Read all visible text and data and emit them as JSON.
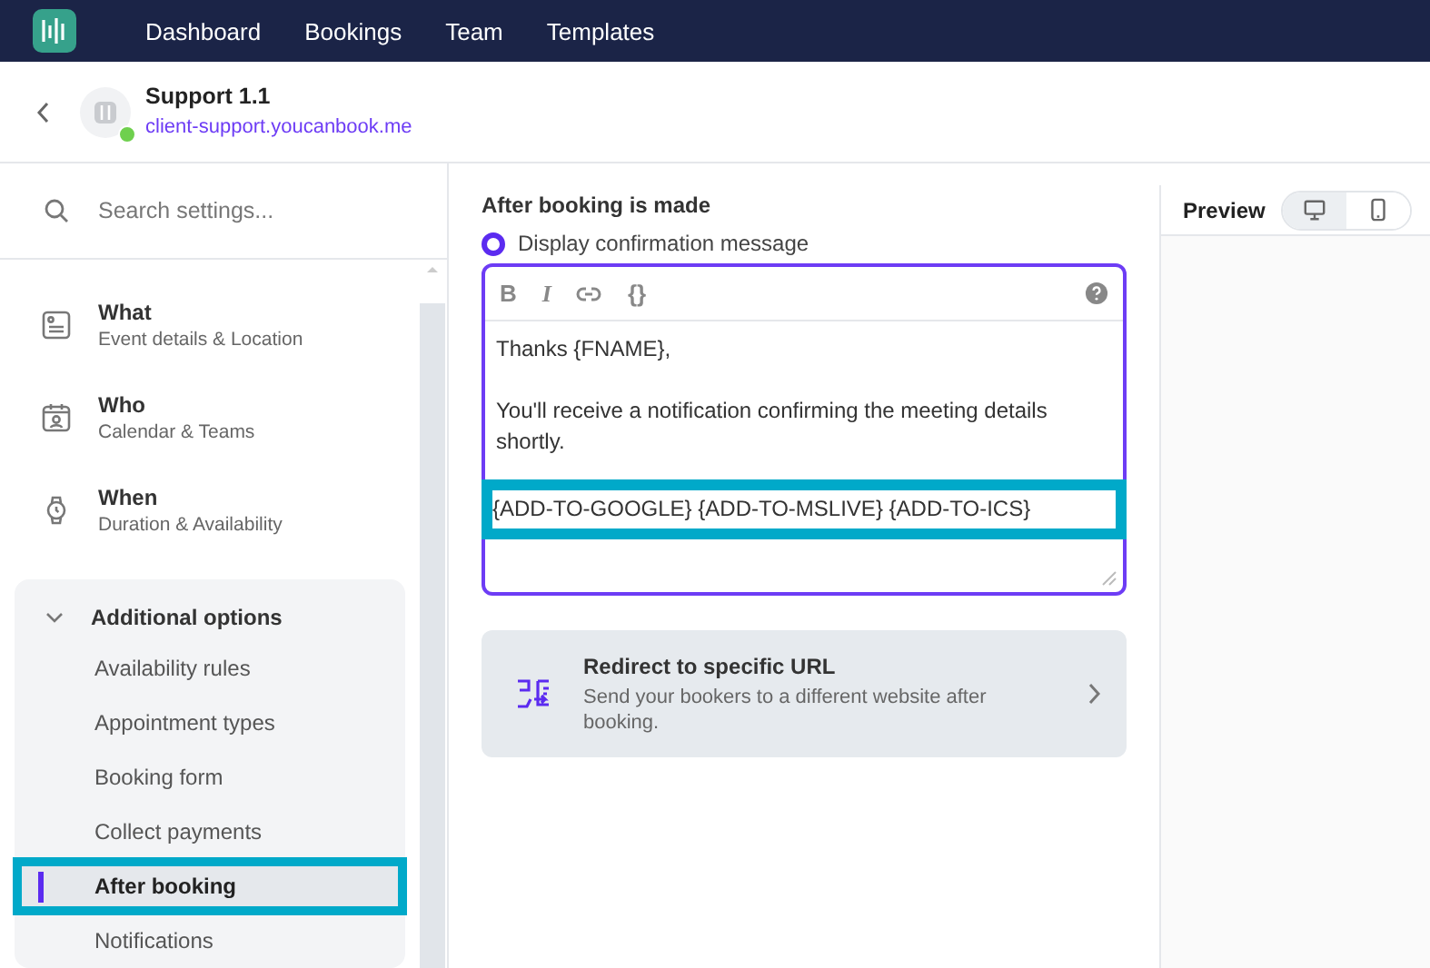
{
  "top_nav": {
    "items": [
      {
        "label": "Dashboard"
      },
      {
        "label": "Bookings"
      },
      {
        "label": "Team"
      },
      {
        "label": "Templates"
      }
    ]
  },
  "header": {
    "title": "Support 1.1",
    "link": "client-support.youcanbook.me",
    "online": true
  },
  "sidebar": {
    "search": {
      "placeholder": "Search settings..."
    },
    "sections": [
      {
        "kind": "what",
        "title": "What",
        "subtitle": "Event details & Location"
      },
      {
        "kind": "who",
        "title": "Who",
        "subtitle": "Calendar & Teams"
      },
      {
        "kind": "when",
        "title": "When",
        "subtitle": "Duration & Availability"
      }
    ],
    "group": {
      "title": "Additional options",
      "expanded": true,
      "items": [
        {
          "label": "Availability rules",
          "selected": false
        },
        {
          "label": "Appointment types",
          "selected": false
        },
        {
          "label": "Booking form",
          "selected": false
        },
        {
          "label": "Collect payments",
          "selected": false
        },
        {
          "label": "After booking",
          "selected": true,
          "highlighted": true
        },
        {
          "label": "Notifications",
          "selected": false
        }
      ]
    }
  },
  "main": {
    "heading": "After booking is made",
    "option": {
      "label": "Display confirmation message",
      "selected": true
    },
    "editor": {
      "toolbar": [
        {
          "kind": "bold",
          "label": "B"
        },
        {
          "kind": "italic",
          "label": "I"
        },
        {
          "kind": "link"
        },
        {
          "kind": "braces",
          "label": "{}"
        }
      ],
      "paragraphs": [
        {
          "text": "Thanks {FNAME},",
          "highlighted": false
        },
        {
          "text": "You'll receive a notification confirming the meeting details shortly.",
          "highlighted": false
        },
        {
          "text": "{ADD-TO-GOOGLE} {ADD-TO-MSLIVE} {ADD-TO-ICS}",
          "highlighted": true
        }
      ]
    },
    "redirect": {
      "title": "Redirect to specific URL",
      "description": "Send your bookers to a different website after booking."
    }
  },
  "preview": {
    "title": "Preview",
    "devices": [
      {
        "kind": "desktop",
        "selected": true
      },
      {
        "kind": "mobile",
        "selected": false
      }
    ]
  }
}
